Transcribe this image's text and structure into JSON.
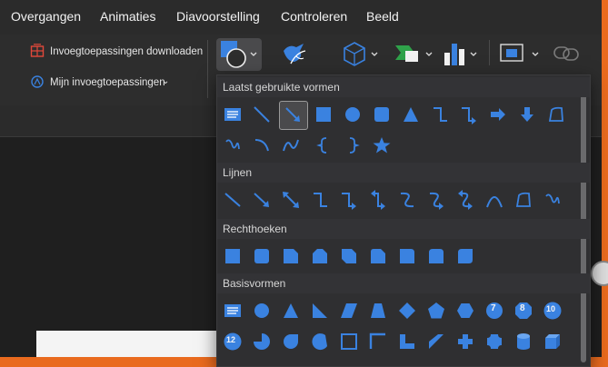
{
  "menu": [
    "Overgangen",
    "Animaties",
    "Diavoorstelling",
    "Controleren",
    "Beeld"
  ],
  "ribbon": {
    "addins_download": "Invoegtoepassingen downloaden",
    "my_addins": "Mijn invoegtoepassingen"
  },
  "shapes_panel": {
    "sections": [
      "Laatst gebruikte vormen",
      "Lijnen",
      "Rechthoeken",
      "Basisvormen"
    ],
    "basic_numbers": [
      "7",
      "8",
      "10",
      "12"
    ]
  },
  "colors": {
    "accent": "#3a82e0",
    "orange_border": "#e96a1e"
  }
}
